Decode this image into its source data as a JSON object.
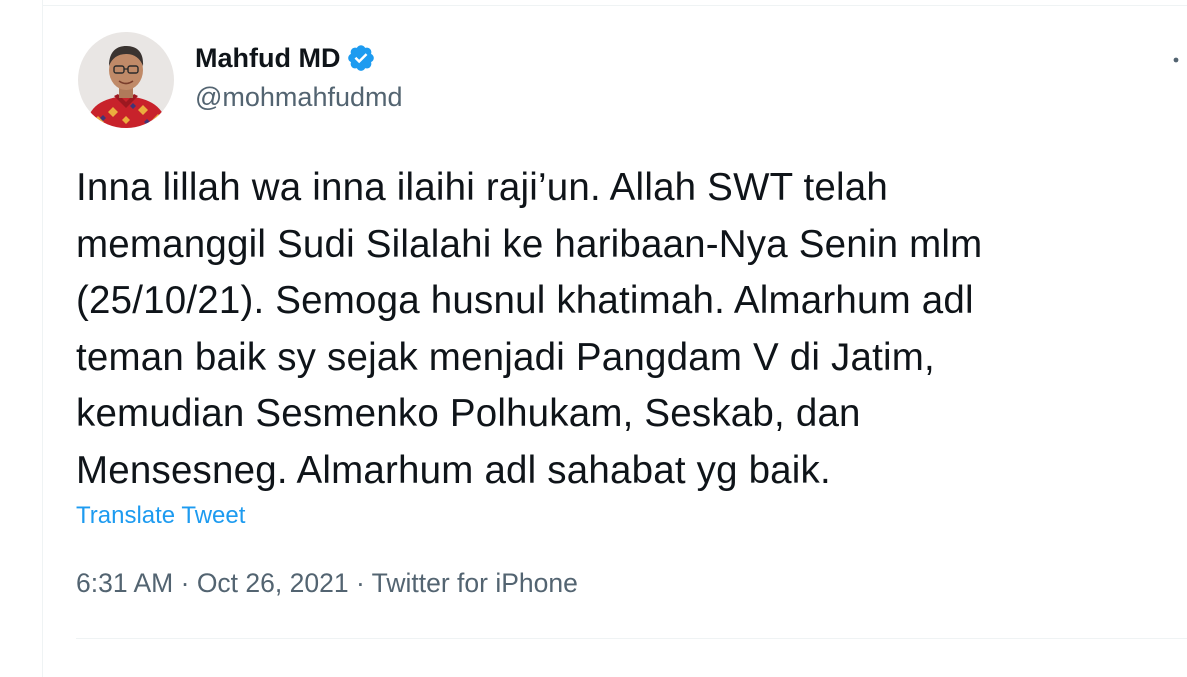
{
  "author": {
    "name": "Mahfud MD",
    "handle": "@mohmahfudmd",
    "verified": true
  },
  "tweet": {
    "lines": [
      "Inna lillah wa inna ilaihi raji’un. Allah SWT telah",
      "memanggil Sudi Silalahi ke haribaan-Nya Senin mlm",
      "(25/10/21). Semoga husnul khatimah. Almarhum adl",
      "teman baik sy sejak menjadi Pangdam V di Jatim,",
      "kemudian Sesmenko Polhukam, Seskab, dan",
      "Mensesneg. Almarhum adl sahabat yg baik."
    ],
    "translate_label": "Translate Tweet"
  },
  "meta": {
    "time": "6:31 AM",
    "separator": "·",
    "date": "Oct 26, 2021",
    "source": "Twitter for iPhone"
  },
  "icons": {
    "verified": "verified-badge-icon",
    "more": "more-options-icon"
  },
  "colors": {
    "text": "#0f1419",
    "secondary": "#536471",
    "accent": "#1d9bf0",
    "border": "#eff3f4"
  }
}
